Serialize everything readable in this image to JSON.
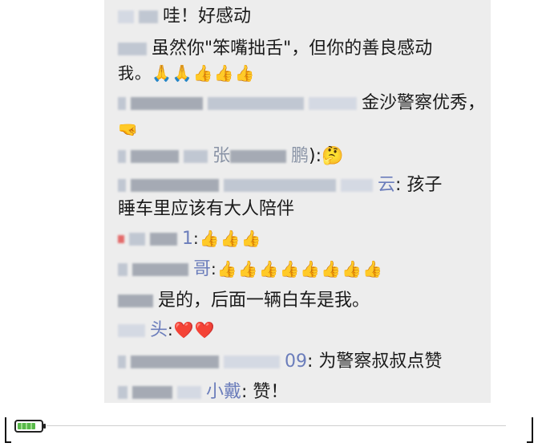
{
  "messages": [
    {
      "text": "哇！好感动"
    },
    {
      "text": "虽然你\"笨嘴拙舌\"，但你的善良感动"
    },
    {
      "text": "我。🙏🙏👍👍👍"
    },
    {
      "text": "金沙警察优秀，"
    },
    {
      "text": "🤜"
    },
    {
      "prefix": "张",
      "suffix": "鹏",
      "text": "):🤔"
    },
    {
      "name_end": "云",
      "text": ": 孩子"
    },
    {
      "text": "睡车里应该有大人陪伴"
    },
    {
      "name_end": "1",
      "text": ":👍👍👍"
    },
    {
      "name_end": "哥",
      "text": ":👍👍👍👍👍👍👍👍"
    },
    {
      "text": "是的，后面一辆白车是我。"
    },
    {
      "name_end": "头",
      "text": ":❤️❤️"
    },
    {
      "name_end": "09",
      "text": ": 为警察叔叔点赞"
    },
    {
      "name_end": "小戴",
      "text": ": 赞！"
    }
  ],
  "status": {
    "battery_level": 0.7
  }
}
